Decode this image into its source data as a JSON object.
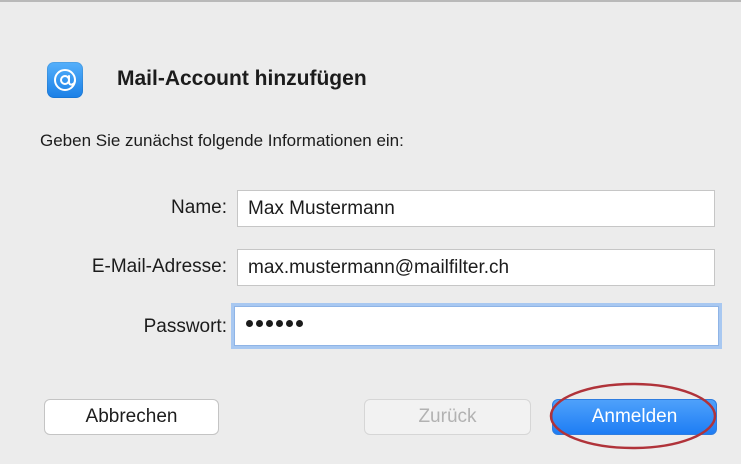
{
  "dialog": {
    "title": "Mail-Account hinzufügen",
    "instructions": "Geben Sie zunächst folgende Informationen ein:",
    "icon": "mail-at-icon",
    "accent_color": "#2f86f5"
  },
  "form": {
    "name_label": "Name:",
    "name_value": "Max Mustermann",
    "email_label": "E-Mail-Adresse:",
    "email_value": "max.mustermann@mailfilter.ch",
    "password_label": "Passwort:",
    "password_mask": "••••••",
    "password_length": 6
  },
  "buttons": {
    "cancel_label": "Abbrechen",
    "back_label": "Zurück",
    "login_label": "Anmelden"
  },
  "annotation": {
    "highlight_color": "#b0333a",
    "highlighted": "login-button"
  }
}
